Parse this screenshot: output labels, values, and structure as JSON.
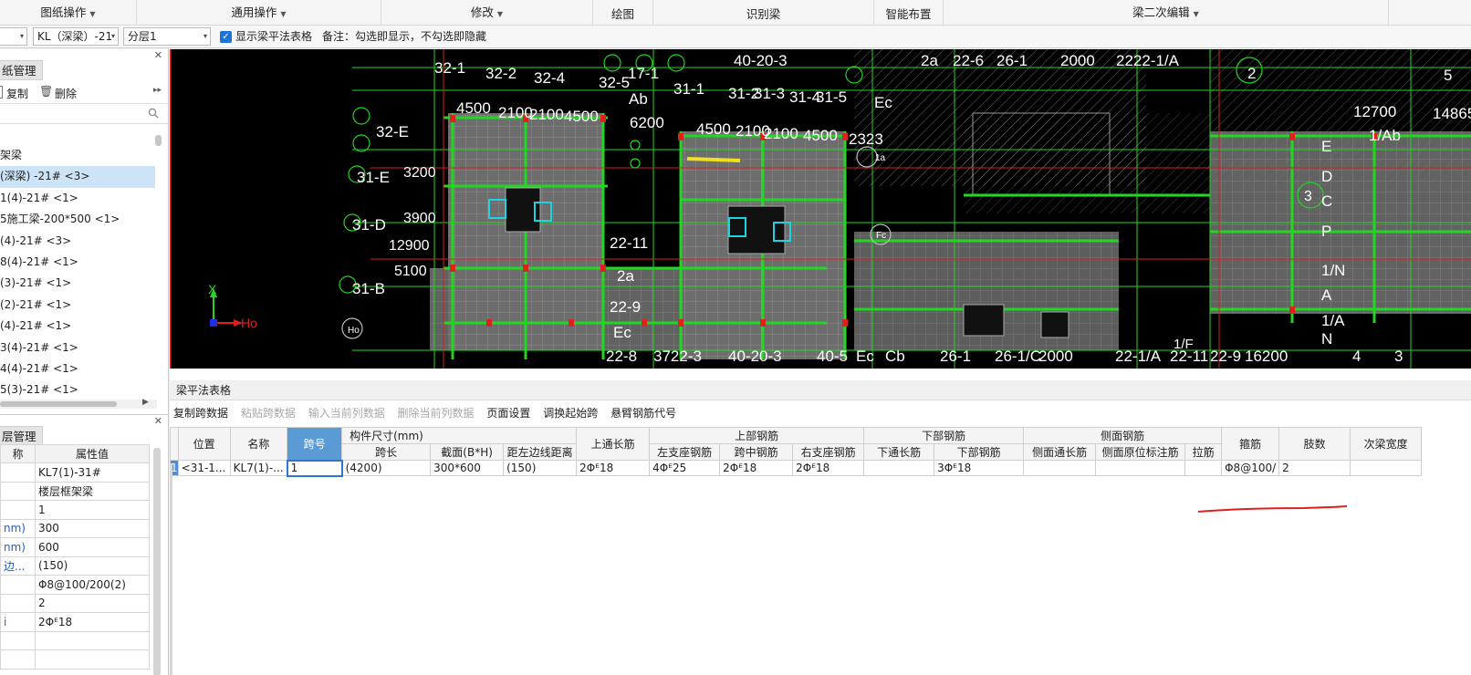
{
  "menu": [
    {
      "label": "图纸操作",
      "dropdown": true
    },
    {
      "label": "通用操作",
      "dropdown": true
    },
    {
      "label": "修改",
      "dropdown": true
    },
    {
      "label": "绘图",
      "dropdown": false
    },
    {
      "label": "识别梁",
      "dropdown": false
    },
    {
      "label": "智能布置",
      "dropdown": false
    },
    {
      "label": "梁二次编辑",
      "dropdown": true
    }
  ],
  "toolbar": {
    "combo_type": "KL（深梁）-21",
    "combo_floor": "分层1",
    "show_table_label": "显示梁平法表格",
    "note": "备注：勾选即显示，不勾选即隐藏"
  },
  "drawing_panel": {
    "title": "纸管理",
    "copy_label": "复制",
    "delete_label": "删除",
    "items": [
      "架梁",
      "(深梁) -21# <3>",
      "1(4)-21# <1>",
      "5施工梁-200*500 <1>",
      "(4)-21# <3>",
      "8(4)-21# <1>",
      "(3)-21# <1>",
      "(2)-21# <1>",
      "(4)-21# <1>",
      "3(4)-21# <1>",
      "4(4)-21# <1>",
      "5(3)-21# <1>"
    ],
    "selected_index": 1
  },
  "property_panel": {
    "title": "层管理",
    "col_name": "称",
    "col_value": "属性值",
    "rows": [
      {
        "k": "",
        "v": "KL7(1)-31#"
      },
      {
        "k": "",
        "v": "楼层框架梁"
      },
      {
        "k": "",
        "v": "1"
      },
      {
        "k": "nm)",
        "v": "300"
      },
      {
        "k": "nm)",
        "v": "600"
      },
      {
        "k": "边...",
        "v": "(150)"
      },
      {
        "k": "",
        "v": "Φ8@100/200(2)"
      },
      {
        "k": "",
        "v": "2"
      },
      {
        "k": "i",
        "v": "2Φᴱ18"
      },
      {
        "k": "",
        "v": ""
      },
      {
        "k": "",
        "v": ""
      }
    ]
  },
  "cad_labels": [
    "32-1",
    "32-2",
    "32-4",
    "32-5",
    "17-1",
    "31-1",
    "31-2",
    "31-3",
    "31-4",
    "31-5",
    "Ec",
    "40-20-3",
    "2a",
    "22-6",
    "26-1",
    "2000",
    "2222-1/A",
    "2",
    "12700",
    "1/Ab",
    "5",
    "14865",
    "4500",
    "2100",
    "2100",
    "4500",
    "6200",
    "4500",
    "2100",
    "2100",
    "4500",
    "2323",
    "32-E",
    "31-E",
    "31-D",
    "31-B",
    "3900",
    "3200",
    "12900",
    "5100",
    "22-11",
    "2a",
    "22-9",
    "Ec",
    "22-8",
    "3722-3",
    "40-20-3",
    "40-5",
    "Ec",
    "Cb",
    "26-1",
    "26-1/C",
    "2000",
    "22-1/A",
    "22-11",
    "22-9",
    "16200",
    "4",
    "3",
    "E",
    "D",
    "C",
    "P",
    "1/N",
    "A",
    "1/A",
    "N",
    "1/F",
    "Y",
    "X",
    "Ho",
    "Fc",
    "1a",
    "3",
    "Ab"
  ],
  "table": {
    "title": "梁平法表格",
    "actions": [
      {
        "label": "复制跨数据",
        "enabled": true
      },
      {
        "label": "粘贴跨数据",
        "enabled": false
      },
      {
        "label": "输入当前列数据",
        "enabled": false
      },
      {
        "label": "删除当前列数据",
        "enabled": false
      },
      {
        "label": "页面设置",
        "enabled": true
      },
      {
        "label": "调换起始跨",
        "enabled": true
      },
      {
        "label": "悬臂钢筋代号",
        "enabled": true
      }
    ],
    "group_headers": {
      "size": "构件尺寸(mm)",
      "top": "上部钢筋",
      "bottom": "下部钢筋",
      "side": "侧面钢筋"
    },
    "headers": {
      "position": "位置",
      "name": "名称",
      "span": "跨号",
      "span_len": "跨长",
      "section": "截面(B*H)",
      "edge_dist": "距左边线距离",
      "top_through": "上通长筋",
      "left_support": "左支座钢筋",
      "mid_span": "跨中钢筋",
      "right_support": "右支座钢筋",
      "bottom_through": "下通长筋",
      "bottom_bar": "下部钢筋",
      "side_through": "侧面通长筋",
      "side_orig": "侧面原位标注筋",
      "tie": "拉筋",
      "stirrup": "箍筋",
      "legs": "肢数",
      "sec_width": "次梁宽度"
    },
    "rows": [
      {
        "num": "1",
        "position": "<31-1...",
        "name": "KL7(1)-...",
        "span": "1",
        "span_len": "(4200)",
        "section": "300*600",
        "edge_dist": "(150)",
        "top_through": "2Φᴱ18",
        "left_support": "4Φᴱ25",
        "mid_span": "2Φᴱ18",
        "right_support": "2Φᴱ18",
        "bottom_through": "",
        "bottom_bar": "3Φᴱ18",
        "side_through": "",
        "side_orig": "",
        "tie": "",
        "stirrup": "Φ8@100/",
        "legs": "2",
        "sec_width": ""
      }
    ]
  },
  "colors": {
    "accent": "#1e73d6",
    "header_highlight": "#5b9bd5",
    "annotation": "#e02020"
  }
}
